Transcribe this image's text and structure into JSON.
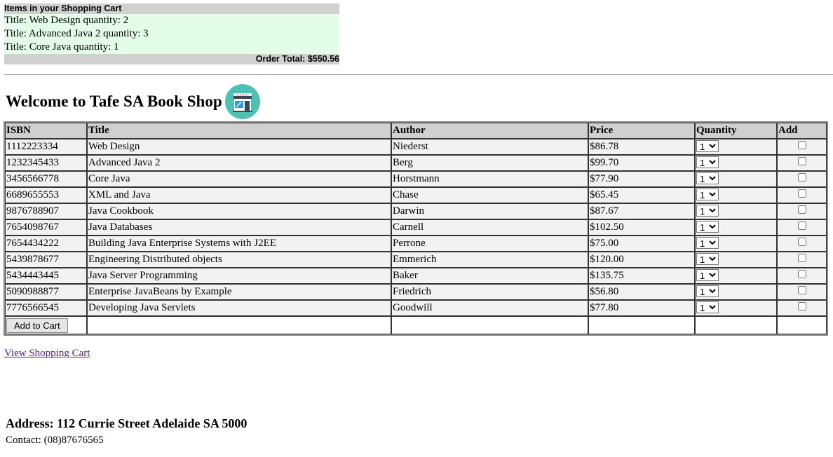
{
  "cart": {
    "header": "Items in your Shopping Cart",
    "items": [
      "Title: Web Design quantity: 2",
      "Title: Advanced Java 2 quantity: 3",
      "Title: Core Java quantity: 1"
    ],
    "total": "Order Total: $550.56"
  },
  "shop": {
    "title": "Welcome to Tafe SA Book Shop",
    "logo_icon": "storefront-icon",
    "logo_colors": {
      "circle": "#4fc1b3",
      "awning": "#3a4657",
      "window": "#2f9fd8"
    }
  },
  "table": {
    "headers": [
      "ISBN",
      "Title",
      "Author",
      "Price",
      "Quantity",
      "Add"
    ],
    "rows": [
      {
        "isbn": "1112223334",
        "title": "Web Design",
        "author": "Niederst",
        "price": "$86.78",
        "qty": "1"
      },
      {
        "isbn": "1232345433",
        "title": "Advanced Java 2",
        "author": "Berg",
        "price": "$99.70",
        "qty": "1"
      },
      {
        "isbn": "3456566778",
        "title": "Core Java",
        "author": "Horstmann",
        "price": "$77.90",
        "qty": "1"
      },
      {
        "isbn": "6689655553",
        "title": "XML and Java",
        "author": "Chase",
        "price": "$65.45",
        "qty": "1"
      },
      {
        "isbn": "9876788907",
        "title": "Java Cookbook",
        "author": "Darwin",
        "price": "$87.67",
        "qty": "1"
      },
      {
        "isbn": "7654098767",
        "title": "Java Databases",
        "author": "Carnell",
        "price": "$102.50",
        "qty": "1"
      },
      {
        "isbn": "7654434222",
        "title": "Building Java Enterprise Systems with J2EE",
        "author": "Perrone",
        "price": "$75.00",
        "qty": "1"
      },
      {
        "isbn": "5439878677",
        "title": "Engineering Distributed objects",
        "author": "Emmerich",
        "price": "$120.00",
        "qty": "1"
      },
      {
        "isbn": "5434443445",
        "title": "Java Server Programming",
        "author": "Baker",
        "price": "$135.75",
        "qty": "1"
      },
      {
        "isbn": "5090988877",
        "title": "Enterprise JavaBeans by Example",
        "author": "Friedrich",
        "price": "$56.80",
        "qty": "1"
      },
      {
        "isbn": "7776566545",
        "title": "Developing Java Servlets",
        "author": "Goodwill",
        "price": "$77.80",
        "qty": "1"
      }
    ],
    "add_button_label": "Add to Cart"
  },
  "links": {
    "view_cart": "View Shopping Cart"
  },
  "footer": {
    "address": "Address: 112 Currie Street Adelaide SA 5000",
    "contact": "Contact: (08)87676565"
  }
}
